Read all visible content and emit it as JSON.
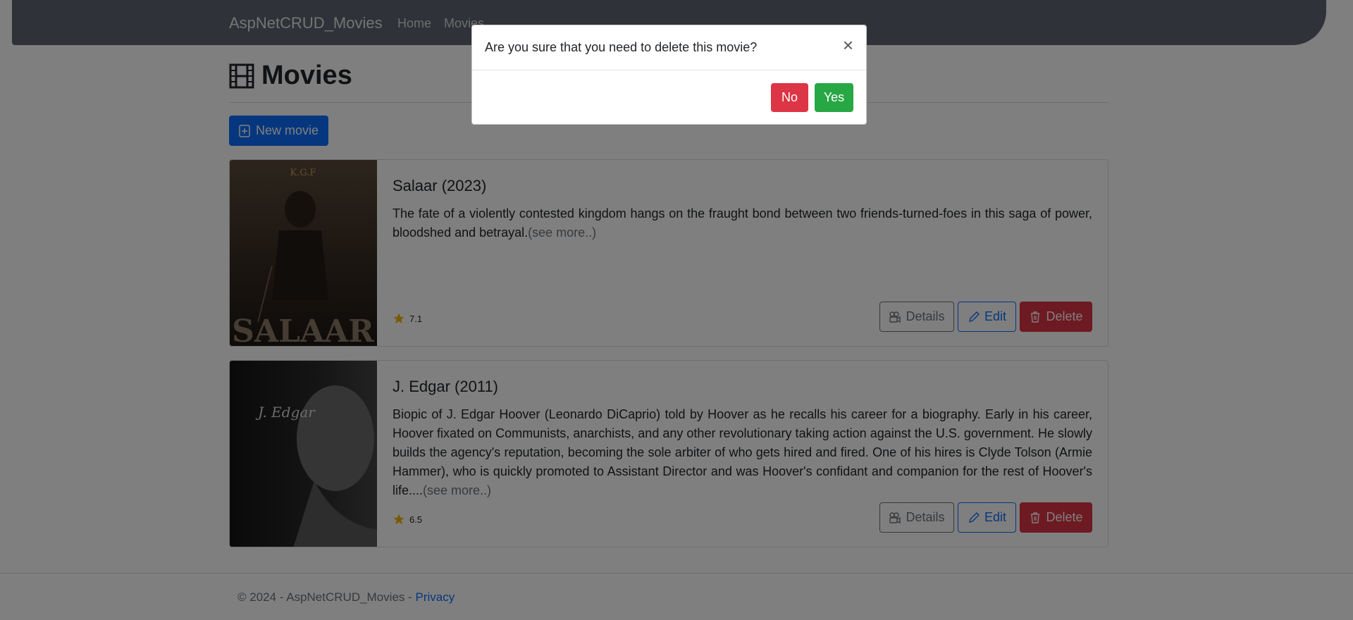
{
  "navbar": {
    "brand": "AspNetCRUD_Movies",
    "links": [
      {
        "label": "Home"
      },
      {
        "label": "Movies"
      }
    ]
  },
  "page": {
    "title": "Movies",
    "new_button_label": "New movie"
  },
  "movies": [
    {
      "title": "Salaar (2023)",
      "description": "The fate of a violently contested kingdom hangs on the fraught bond between two friends-turned-foes in this saga of power, bloodshed and betrayal.",
      "see_more": "(see more..)",
      "rating": "7.1",
      "poster_text": "SALAAR",
      "poster_top_text": "K.G.F",
      "details_label": "Details",
      "edit_label": "Edit",
      "delete_label": "Delete"
    },
    {
      "title": "J. Edgar (2011)",
      "description": "Biopic of J. Edgar Hoover (Leonardo DiCaprio) told by Hoover as he recalls his career for a biography. Early in his career, Hoover fixated on Communists, anarchists, and any other revolutionary taking action against the U.S. government. He slowly builds the agency's reputation, becoming the sole arbiter of who gets hired and fired. One of his hires is Clyde Tolson (Armie Hammer), who is quickly promoted to Assistant Director and was Hoover's confidant and companion for the rest of Hoover's life....",
      "see_more": "(see more..)",
      "rating": "6.5",
      "poster_text": "J. Edgar",
      "details_label": "Details",
      "edit_label": "Edit",
      "delete_label": "Delete"
    }
  ],
  "footer": {
    "text": "© 2024 - AspNetCRUD_Movies - ",
    "privacy_label": "Privacy"
  },
  "modal": {
    "title": "Are you sure that you need to delete this movie?",
    "close_symbol": "×",
    "no_label": "No",
    "yes_label": "Yes"
  },
  "colors": {
    "navbar": "#5f6570",
    "primary": "#0d6efd",
    "danger": "#dc3545",
    "success": "#28a745",
    "star": "#f5b301"
  }
}
